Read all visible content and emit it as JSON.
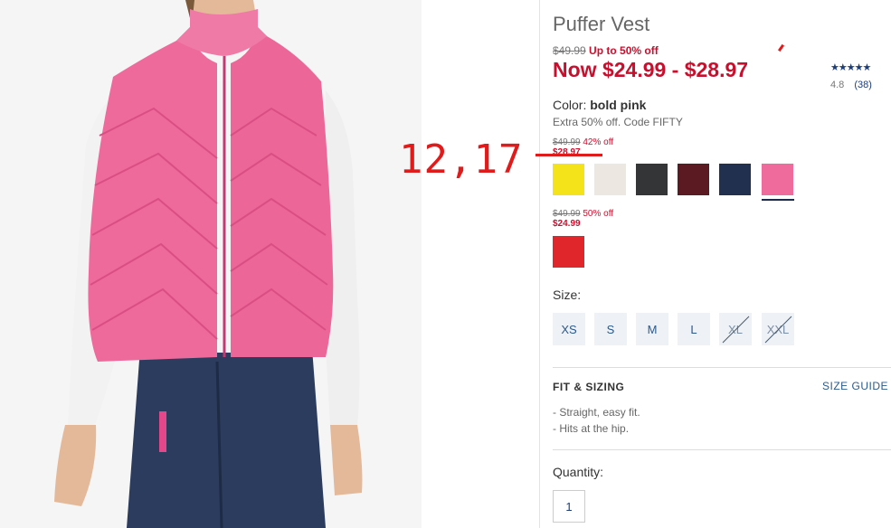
{
  "product": {
    "title": "Puffer Vest",
    "was_price": "$49.99",
    "discount_text": "Up to 50% off",
    "now_price": "Now $24.99 - $28.97",
    "rating_stars": "★★★★★",
    "rating_value": "4.8",
    "review_count": "(38)"
  },
  "color": {
    "label": "Color:",
    "selected": "bold pink",
    "promo": "Extra 50% off. Code FIFTY",
    "groups": [
      {
        "was": "$49.99",
        "off": "42% off",
        "now": "$28.97",
        "swatches": [
          {
            "name": "yellow",
            "color": "#f4e31a"
          },
          {
            "name": "cream",
            "color": "#ece7e1"
          },
          {
            "name": "charcoal",
            "color": "#343536"
          },
          {
            "name": "burgundy",
            "color": "#5b1a22"
          },
          {
            "name": "navy",
            "color": "#22304f"
          },
          {
            "name": "bold pink",
            "color": "#ef6b9c"
          }
        ]
      },
      {
        "was": "$49.99",
        "off": "50% off",
        "now": "$24.99",
        "swatches": [
          {
            "name": "red",
            "color": "#e1262b"
          }
        ]
      }
    ]
  },
  "size": {
    "label": "Size:",
    "options": [
      {
        "label": "XS",
        "available": true
      },
      {
        "label": "S",
        "available": true
      },
      {
        "label": "M",
        "available": true
      },
      {
        "label": "L",
        "available": true
      },
      {
        "label": "XL",
        "available": false
      },
      {
        "label": "XXL",
        "available": false
      }
    ]
  },
  "fit": {
    "title": "FIT & SIZING",
    "size_guide": "SIZE GUIDE",
    "bullets": [
      "- Straight, easy fit.",
      "- Hits at the hip."
    ]
  },
  "quantity": {
    "label": "Quantity:",
    "value": "1"
  },
  "annotation": {
    "text": "12,17",
    "color": "#e01b1b"
  }
}
